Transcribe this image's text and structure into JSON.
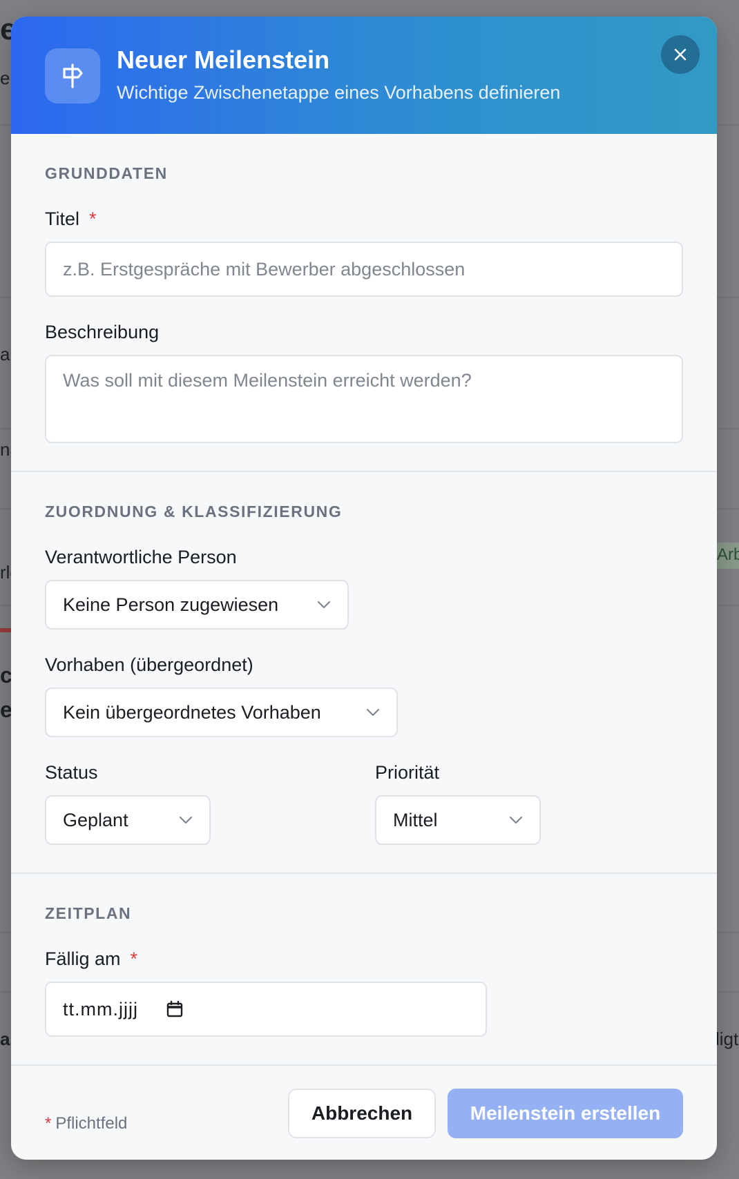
{
  "background": {
    "fragments": [
      "e",
      "er",
      "al",
      "na",
      "rle",
      "ck",
      "e",
      "as",
      "Arb",
      "ligt"
    ]
  },
  "modal": {
    "title": "Neuer Meilenstein",
    "subtitle": "Wichtige Zwischenetappe eines Vorhabens definieren",
    "close_icon": "close-icon",
    "header_icon": "signpost-icon"
  },
  "sections": {
    "basics": {
      "title": "GRUNDDATEN",
      "title_field": {
        "label": "Titel",
        "required_mark": "*",
        "placeholder": "z.B. Erstgespräche mit Bewerber abgeschlossen"
      },
      "description_field": {
        "label": "Beschreibung",
        "placeholder": "Was soll mit diesem Meilenstein erreicht werden?"
      }
    },
    "assignment": {
      "title": "ZUORDNUNG & KLASSIFIZIERUNG",
      "person": {
        "label": "Verantwortliche Person",
        "value": "Keine Person zugewiesen"
      },
      "parent": {
        "label": "Vorhaben (übergeordnet)",
        "value": "Kein übergeordnetes Vorhaben"
      },
      "status": {
        "label": "Status",
        "value": "Geplant"
      },
      "priority": {
        "label": "Priorität",
        "value": "Mittel"
      }
    },
    "schedule": {
      "title": "ZEITPLAN",
      "due": {
        "label": "Fällig am",
        "required_mark": "*",
        "value": "tt.mm.jjjj"
      }
    }
  },
  "footer": {
    "required_note_mark": "*",
    "required_note": "Pflichtfeld",
    "cancel_label": "Abbrechen",
    "submit_label": "Meilenstein erstellen"
  },
  "colors": {
    "header_gradient_start": "#2d68f0",
    "header_gradient_end": "#3299c4",
    "required": "#e0393e",
    "submit_disabled": "#95b1f4"
  }
}
